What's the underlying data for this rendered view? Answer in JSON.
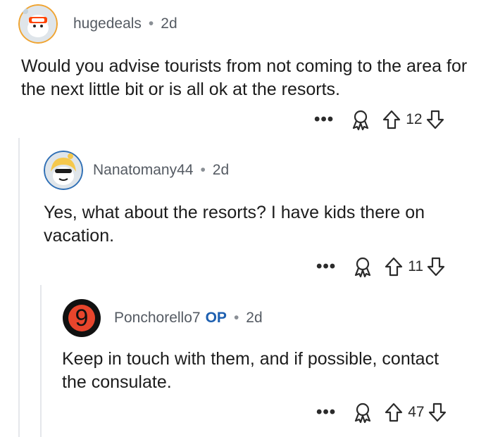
{
  "comments": [
    {
      "username": "hugedeals",
      "age": "2d",
      "text": "Would you advise tourists from not coming to the area for the next little bit or is all ok at the resorts.",
      "score": "12",
      "op_badge": ""
    },
    {
      "username": "Nanatomany44",
      "age": "2d",
      "text": "Yes, what about the resorts?  I have kids there on vacation.",
      "score": "11",
      "op_badge": ""
    },
    {
      "username": "Ponchorello7",
      "age": "2d",
      "text": "Keep in touch with them, and if possible, contact the consulate.",
      "score": "47",
      "op_badge": "OP",
      "avatar_digit": "9"
    }
  ],
  "separator": "•",
  "more_label": "•••",
  "colors": {
    "op": "#1d5fb0",
    "meta": "#555b63",
    "thread_line": "#e5e7eb"
  },
  "icons": [
    "award-icon",
    "upvote-icon",
    "downvote-icon",
    "more-options-icon"
  ]
}
